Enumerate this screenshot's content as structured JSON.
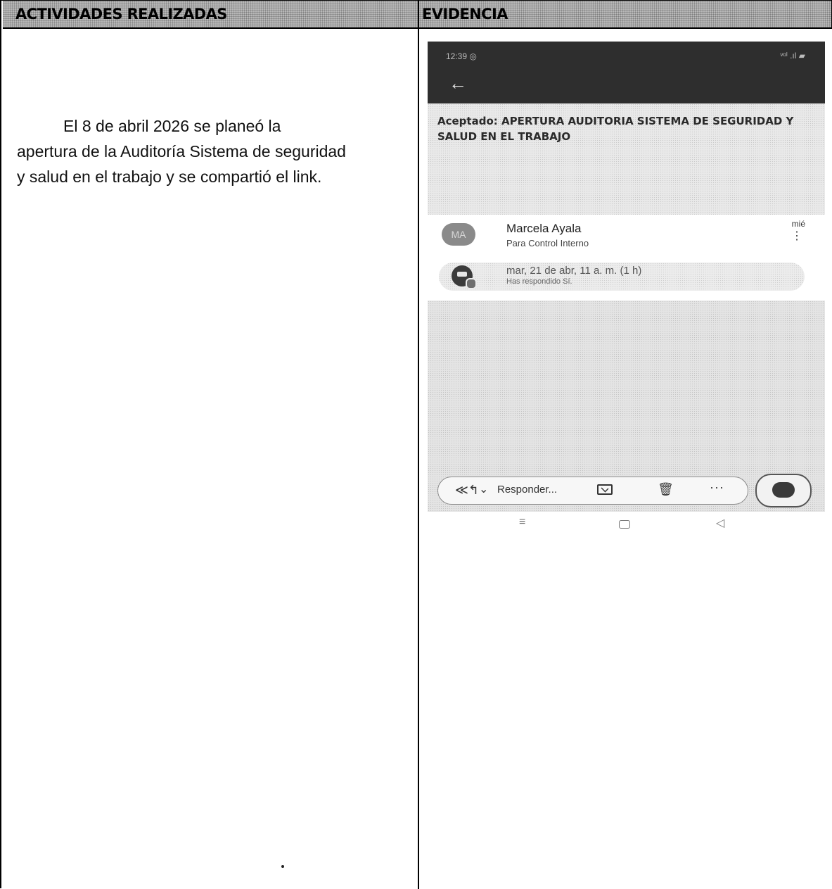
{
  "table": {
    "header_left": "ACTIVIDADES REALIZADAS",
    "header_right": "EVIDENCIA"
  },
  "activity": {
    "line1": "El 8 de abril 2026 se planeó la",
    "line2": "apertura de la Auditoría Sistema de seguridad",
    "line3": "y salud en el trabajo y se compartió el link."
  },
  "evidence": {
    "status_bar": {
      "time": "12:39 ◎",
      "icons": "ᵛᵒˡ .ıl ▰"
    },
    "back_icon": "←",
    "email": {
      "subject": "Aceptado: APERTURA AUDITORIA SISTEMA DE SEGURIDAD Y SALUD EN EL TRABAJO",
      "avatar_initials": "MA",
      "sender_name": "Marcela Ayala",
      "recipient": "Para Control Interno",
      "day": "mié",
      "kebab": "⋮"
    },
    "event": {
      "date": "mar, 21 de abr, 11 a. m. (1 h)",
      "status": "Has respondido Sí."
    },
    "action_bar": {
      "reply_all_icon": "≪↰",
      "chevron": "⌄",
      "reply_label": "Responder...",
      "trash_icon": "🗑",
      "more_icon": "···"
    },
    "nav_bar": {
      "menu_icon": "≡",
      "back_icon": "◁"
    }
  },
  "icons": [
    "back-arrow-icon",
    "kebab-icon",
    "calendar-icon",
    "reply-all-icon",
    "chevron-down-icon",
    "mail-icon",
    "trash-icon",
    "more-icon",
    "copilot-icon",
    "nav-menu-icon",
    "nav-home-icon",
    "nav-back-icon"
  ]
}
